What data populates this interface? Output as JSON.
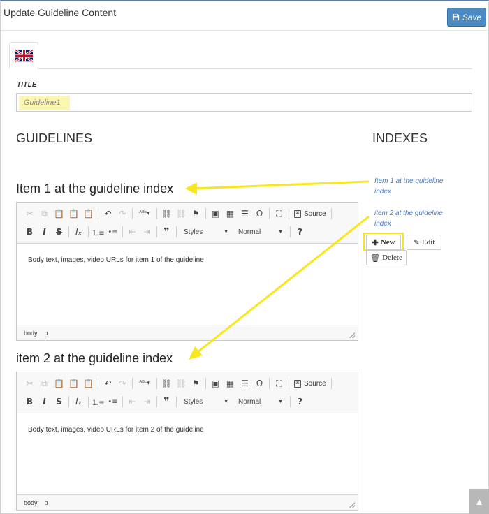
{
  "header": {
    "title": "Update Guideline Content",
    "save_label": "Save"
  },
  "language_tabs": [
    {
      "icon": "uk-flag-icon",
      "active": true
    }
  ],
  "form": {
    "title_label": "TITLE",
    "title_value": "Guideline1"
  },
  "sections": {
    "guidelines_heading": "GUIDELINES",
    "indexes_heading": "INDEXES"
  },
  "guidelines": [
    {
      "heading": "Item 1 at the guideline index",
      "body": "Body text, images, video URLs for item 1 of the guideline",
      "statusbar": [
        "body",
        "p"
      ]
    },
    {
      "heading": "item 2 at the guideline index",
      "body": "Body text, images, video URLs for item 2 of the guideline",
      "statusbar": [
        "body",
        "p"
      ]
    }
  ],
  "toolbar": {
    "styles_label": "Styles",
    "format_label": "Normal",
    "source_label": "Source"
  },
  "indexes": {
    "items": [
      {
        "line1": "Item 1 at the guideline",
        "line2": "index"
      },
      {
        "line1": "item 2 at the guideline",
        "line2": "index"
      }
    ],
    "new_label": "New",
    "edit_label": "Edit",
    "delete_label": "Delete"
  },
  "colors": {
    "accent": "#4a8bc4",
    "highlight": "#f8e71c",
    "link": "#4b7bbf"
  }
}
